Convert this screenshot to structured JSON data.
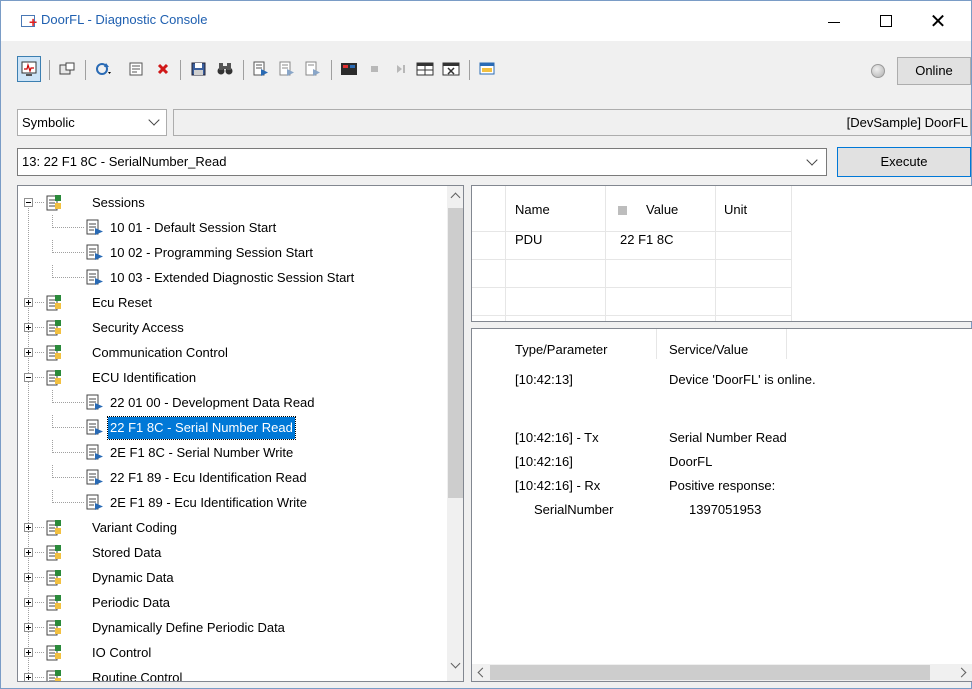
{
  "window": {
    "title": "DoorFL - Diagnostic Console"
  },
  "toolbar": {
    "online_label": "Online"
  },
  "mode_select": {
    "value": "Symbolic"
  },
  "path_field": {
    "value": "[DevSample] DoorFL"
  },
  "command_select": {
    "value": "13: 22 F1 8C - SerialNumber_Read"
  },
  "execute_label": "Execute",
  "tree": {
    "items": [
      {
        "label": "Sessions",
        "kind": "folder",
        "expanded": true
      },
      {
        "label": "10 01 - Default Session Start",
        "kind": "service"
      },
      {
        "label": "10 02 - Programming Session Start",
        "kind": "service"
      },
      {
        "label": "10 03 - Extended Diagnostic Session Start",
        "kind": "service"
      },
      {
        "label": "Ecu Reset",
        "kind": "folder",
        "expanded": false
      },
      {
        "label": "Security Access",
        "kind": "folder",
        "expanded": false
      },
      {
        "label": "Communication Control",
        "kind": "folder",
        "expanded": false
      },
      {
        "label": "ECU Identification",
        "kind": "folder",
        "expanded": true
      },
      {
        "label": "22 01 00 - Development Data Read",
        "kind": "service"
      },
      {
        "label": "22 F1 8C - Serial Number Read",
        "kind": "service",
        "selected": true
      },
      {
        "label": "2E F1 8C - Serial Number Write",
        "kind": "service"
      },
      {
        "label": "22 F1 89 - Ecu Identification Read",
        "kind": "service"
      },
      {
        "label": "2E F1 89 - Ecu Identification Write",
        "kind": "service"
      },
      {
        "label": "Variant Coding",
        "kind": "folder",
        "expanded": false
      },
      {
        "label": "Stored Data",
        "kind": "folder",
        "expanded": false
      },
      {
        "label": "Dynamic Data",
        "kind": "folder",
        "expanded": false
      },
      {
        "label": "Periodic Data",
        "kind": "folder",
        "expanded": false
      },
      {
        "label": "Dynamically Define Periodic Data",
        "kind": "folder",
        "expanded": false
      },
      {
        "label": "IO Control",
        "kind": "folder",
        "expanded": false
      },
      {
        "label": "Routine Control",
        "kind": "folder",
        "expanded": false
      }
    ]
  },
  "variables": {
    "headers": {
      "name": "Name",
      "value": "Value",
      "unit": "Unit"
    },
    "rows": [
      {
        "name": "PDU",
        "value": "22 F1 8C",
        "unit": ""
      }
    ]
  },
  "log": {
    "headers": {
      "type": "Type/Parameter",
      "service": "Service/Value"
    },
    "rows": [
      {
        "type": "[10:42:13]",
        "service": "Device 'DoorFL' is online."
      },
      {
        "type": "",
        "service": ""
      },
      {
        "type": "[10:42:16] - Tx",
        "service": "Serial Number Read"
      },
      {
        "type": "[10:42:16]",
        "service": "DoorFL"
      },
      {
        "type": "[10:42:16] - Rx",
        "service": "Positive response:"
      },
      {
        "type": "SerialNumber",
        "service": "1397051953"
      }
    ]
  }
}
